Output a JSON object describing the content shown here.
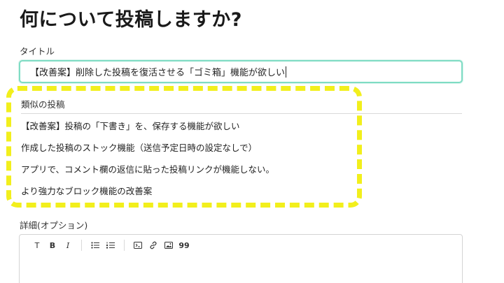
{
  "page": {
    "title": "何について投稿しますか?"
  },
  "title_field": {
    "label": "タイトル",
    "value": "【改善案】削除した投稿を復活させる「ゴミ箱」機能が欲しい"
  },
  "similar_posts": {
    "label": "類似の投稿",
    "items": [
      "【改善案】投稿の「下書き」を、保存する機能が欲しい",
      "作成した投稿のストック機能（送信予定日時の設定なしで）",
      "アプリで、コメント欄の返信に貼った投稿リンクが機能しない。",
      "より強力なブロック機能の改善案"
    ],
    "highlight_color": "#f2ef1c"
  },
  "details_field": {
    "label": "詳細(オプション)",
    "toolbar": {
      "heading": "T",
      "bold": "B",
      "italic": "I",
      "bullet_list": "bullet-list-icon",
      "numbered_list": "numbered-list-icon",
      "code": "code-block-icon",
      "link": "link-icon",
      "image": "image-icon",
      "quote": "99"
    }
  },
  "colors": {
    "input_focus_border": "#7fdcc4"
  }
}
